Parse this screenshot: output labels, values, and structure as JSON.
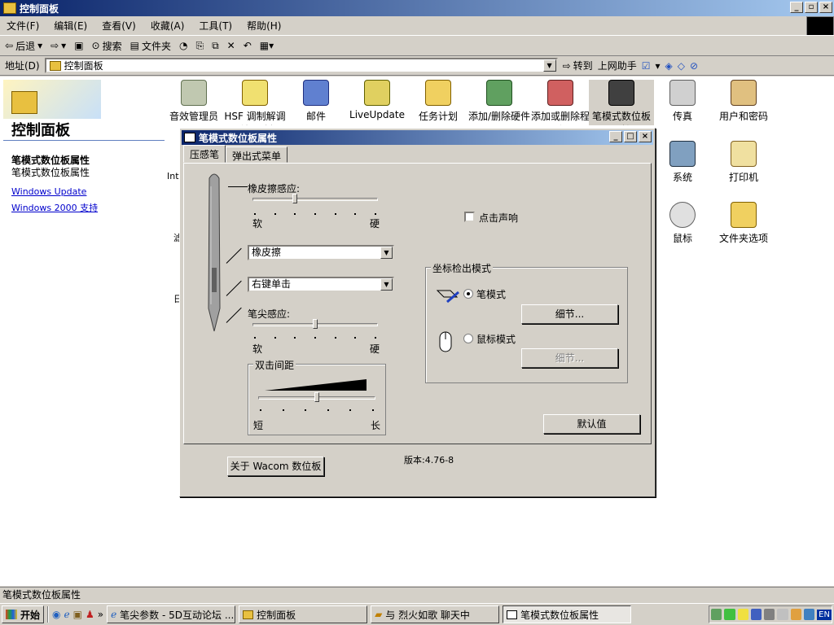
{
  "window": {
    "title": "控制面板"
  },
  "menu": [
    "文件(F)",
    "编辑(E)",
    "查看(V)",
    "收藏(A)",
    "工具(T)",
    "帮助(H)"
  ],
  "toolbar": {
    "back": "后退",
    "search": "搜索",
    "folders": "文件夹"
  },
  "address": {
    "label": "地址(D)",
    "value": "控制面板",
    "go": "转到",
    "online": "上网助手"
  },
  "left": {
    "title": "控制面板",
    "heading": "笔模式数位板属性",
    "desc": "笔模式数位板属性",
    "links": [
      "Windows Update",
      "Windows 2000 支持"
    ]
  },
  "icons_row1": [
    "音效管理员",
    "HSF 调制解调器地区选择",
    "邮件",
    "LiveUpdate",
    "任务计划",
    "添加/删除硬件",
    "添加或删除程序",
    "笔模式数位板属性",
    "传真",
    "用户和密码"
  ],
  "icons_right": [
    "系统",
    "打印机",
    "鼠标",
    "文件夹选项"
  ],
  "partial_labels": [
    "Int",
    "滤",
    "日"
  ],
  "dialog": {
    "title": "笔模式数位板属性",
    "tabs": [
      "压感笔",
      "弹出式菜单"
    ],
    "eraser_label": "橡皮擦感应:",
    "soft": "软",
    "hard": "硬",
    "eraser_select": "橡皮擦",
    "button_select": "右键单击",
    "tip_label": "笔尖感应:",
    "dbl_group": "双击间距",
    "short": "短",
    "long": "长",
    "click_sound": "点击声响",
    "coord_group": "坐标检出模式",
    "pen_mode": "笔模式",
    "mouse_mode": "鼠标模式",
    "details": "细节...",
    "defaults": "默认值",
    "about": "关于 Wacom 数位板",
    "version": "版本:4.76-8"
  },
  "levels": {
    "eraser": 0.33,
    "tip": 0.5,
    "double_click": 0.5
  },
  "status": "笔模式数位板属性",
  "taskbar": {
    "start": "开始",
    "tasks": [
      "笔尖参数 - 5D互动论坛 ...",
      "控制面板",
      "与 烈火如歌 聊天中",
      "笔模式数位板属性"
    ],
    "lang": "EN"
  }
}
